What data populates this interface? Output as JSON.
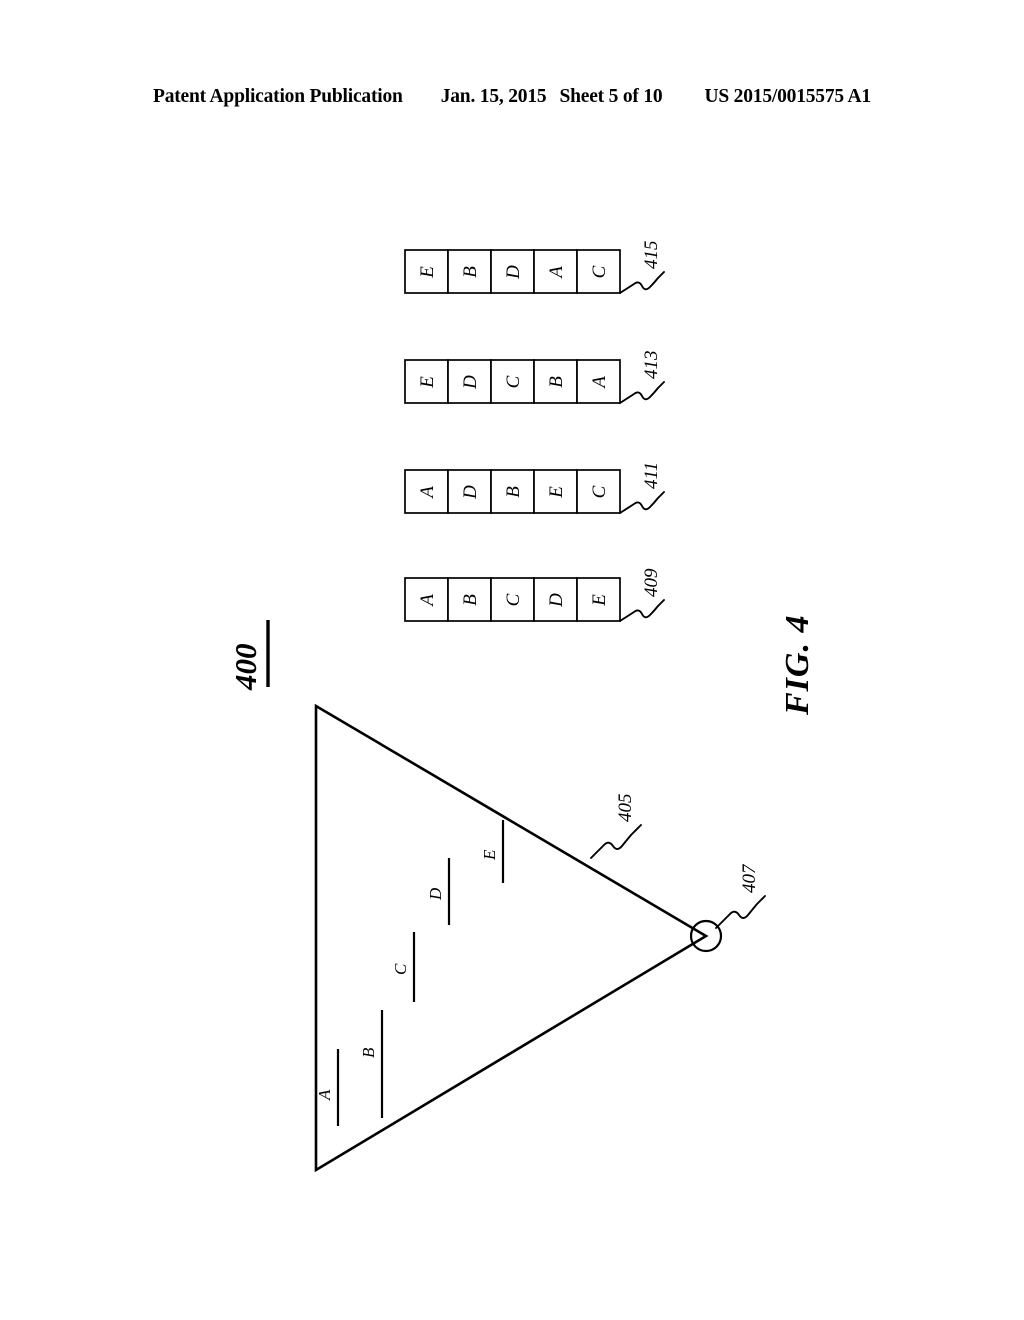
{
  "header": {
    "publication": "Patent Application Publication",
    "date": "Jan. 15, 2015",
    "sheet": "Sheet 5 of 10",
    "patent_number": "US 2015/0015575 A1"
  },
  "figure": {
    "title": "FIG. 4",
    "number": "400",
    "cone": {
      "ref_surface": "405",
      "ref_apex": "407",
      "slices": [
        {
          "label": "A"
        },
        {
          "label": "B"
        },
        {
          "label": "C"
        },
        {
          "label": "D"
        },
        {
          "label": "E"
        }
      ]
    },
    "arrays": [
      {
        "ref": "409",
        "cells": [
          "A",
          "B",
          "C",
          "D",
          "E"
        ]
      },
      {
        "ref": "411",
        "cells": [
          "A",
          "D",
          "B",
          "E",
          "C"
        ]
      },
      {
        "ref": "413",
        "cells": [
          "E",
          "D",
          "C",
          "B",
          "A"
        ]
      },
      {
        "ref": "415",
        "cells": [
          "E",
          "B",
          "D",
          "A",
          "C"
        ]
      }
    ]
  }
}
